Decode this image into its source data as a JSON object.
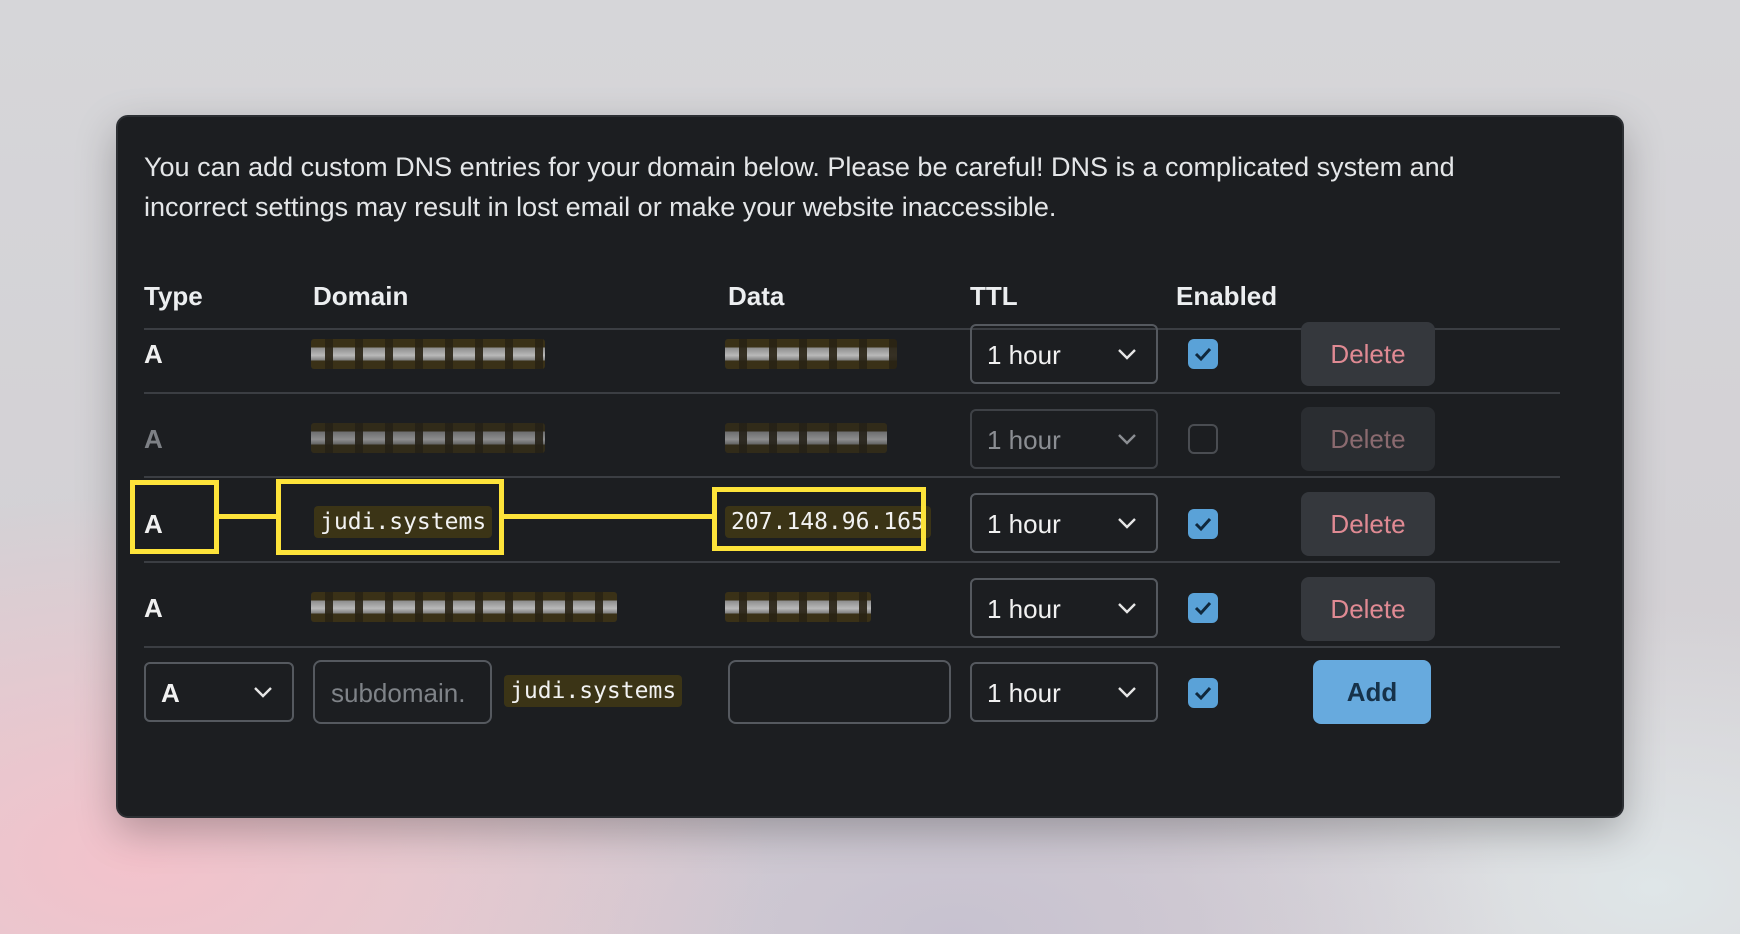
{
  "intro_text": "You can add custom DNS entries for your domain below. Please be careful! DNS is a complicated system and incorrect settings may result in lost email or make your website inaccessible.",
  "columns": {
    "type": "Type",
    "domain": "Domain",
    "data": "Data",
    "ttl": "TTL",
    "enabled": "Enabled"
  },
  "rows": [
    {
      "type": "A",
      "ttl": "1 hour",
      "enabled": true,
      "action": "Delete",
      "domain_redacted": true,
      "data_redacted": true
    },
    {
      "type": "A",
      "ttl": "1 hour",
      "enabled": false,
      "action": "Delete",
      "domain_redacted": true,
      "data_redacted": true
    },
    {
      "type": "A",
      "domain": "judi.systems",
      "data": "207.148.96.165",
      "ttl": "1 hour",
      "enabled": true,
      "action": "Delete",
      "highlighted": true
    },
    {
      "type": "A",
      "ttl": "1 hour",
      "enabled": true,
      "action": "Delete",
      "domain_redacted": true,
      "data_redacted": true
    }
  ],
  "new_entry": {
    "type": "A",
    "subdomain_placeholder": "subdomain.",
    "domain_suffix": "judi.systems",
    "data_value": "",
    "ttl": "1 hour",
    "enabled": true,
    "add_label": "Add"
  },
  "colors": {
    "panel_bg": "#1c1e21",
    "checkbox_on": "#5aa2d8",
    "delete_text": "#e08a93",
    "add_button": "#67aade",
    "highlight": "#fde33a"
  },
  "icons": {
    "chevron": "chevron-down-icon",
    "check": "checkmark-icon"
  }
}
